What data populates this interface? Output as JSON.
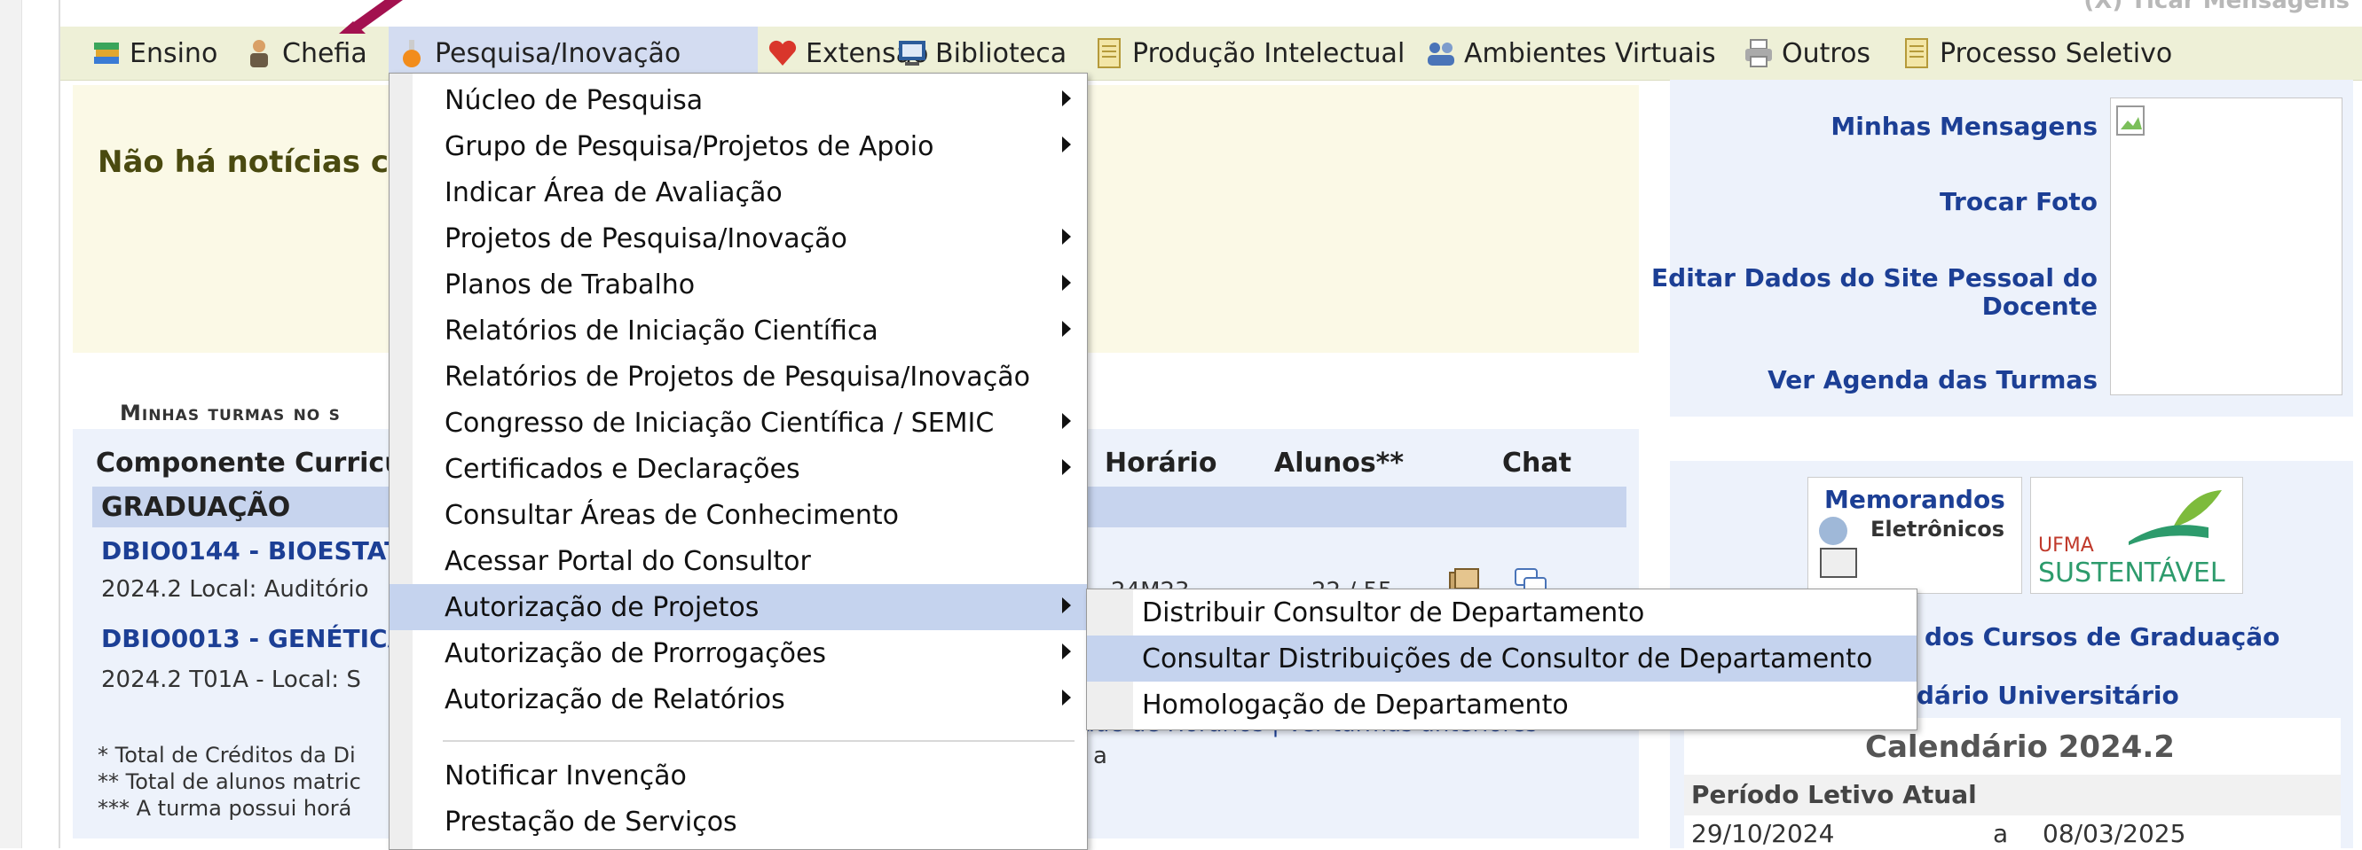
{
  "top_user": "(X) Ticar Mensagens",
  "menubar": {
    "items": [
      {
        "label": "Ensino",
        "icon": "books-icon"
      },
      {
        "label": "Chefia",
        "icon": "person-icon"
      },
      {
        "label": "Pesquisa/Inovação",
        "icon": "flask-icon"
      },
      {
        "label": "Extensão",
        "icon": "heart-icon"
      },
      {
        "label": "Biblioteca",
        "icon": "monitor-icon"
      },
      {
        "label": "Produção Intelectual",
        "icon": "document-icon"
      },
      {
        "label": "Ambientes Virtuais",
        "icon": "people-icon"
      },
      {
        "label": "Outros",
        "icon": "printer-icon"
      },
      {
        "label": "Processo Seletivo",
        "icon": "document-icon"
      }
    ]
  },
  "news": {
    "title": "Não há notícias c"
  },
  "turmas": {
    "heading": "Minhas turmas no s",
    "headers": {
      "componente": "Componente Curricu",
      "horario": "Horário",
      "alunos": "Alunos**",
      "chat": "Chat"
    },
    "group": "GRADUAÇÃO",
    "rows": [
      {
        "link": "DBIO0144 - BIOESTAT",
        "info": "2024.2 Local: Auditório",
        "horario": "24M23",
        "alunos": "22 / 55"
      },
      {
        "link": "DBIO0013 - GENÉTICA",
        "info": "2024.2 T01A - Local: S"
      }
    ],
    "notes": [
      "* Total de Créditos da Di",
      "** Total de alunos matric",
      "*** A turma possui horá"
    ],
    "faint_links": "ade de Horários | Ver turmas anteriores",
    "faint_a": "a"
  },
  "right": {
    "links": [
      "Minhas Mensagens",
      "Trocar Foto",
      "Editar Dados do Site Pessoal do",
      "Docente",
      "Ver Agenda das Turmas"
    ],
    "memorandos_line1": "Memorandos",
    "memorandos_line2": "Eletrônicos",
    "ufma": "UFMA",
    "sustentavel": "SUSTENTÁVEL",
    "cursos_link": "o dos Cursos de Graduação",
    "calendario_link": "ndário Universitário",
    "calendar": {
      "title": "Calendário 2024.2",
      "subtitle": "Período Letivo Atual",
      "start": "29/10/2024",
      "sep": "a",
      "end": "08/03/2025"
    }
  },
  "dropdown": {
    "items": [
      {
        "label": "Núcleo de Pesquisa",
        "submenu": true
      },
      {
        "label": "Grupo de Pesquisa/Projetos de Apoio",
        "submenu": true
      },
      {
        "label": "Indicar Área de Avaliação",
        "submenu": false
      },
      {
        "label": "Projetos de Pesquisa/Inovação",
        "submenu": true
      },
      {
        "label": "Planos de Trabalho",
        "submenu": true
      },
      {
        "label": "Relatórios de Iniciação Científica",
        "submenu": true
      },
      {
        "label": "Relatórios de Projetos de Pesquisa/Inovação",
        "submenu": false
      },
      {
        "label": "Congresso de Iniciação Científica / SEMIC",
        "submenu": true
      },
      {
        "label": "Certificados e Declarações",
        "submenu": true
      },
      {
        "label": "Consultar Áreas de Conhecimento",
        "submenu": false
      },
      {
        "label": "Acessar Portal do Consultor",
        "submenu": false
      },
      {
        "label": "Autorização de Projetos",
        "submenu": true
      },
      {
        "label": "Autorização de Prorrogações",
        "submenu": true
      },
      {
        "label": "Autorização de Relatórios",
        "submenu": true
      },
      {
        "label": "Notificar Invenção",
        "submenu": false
      },
      {
        "label": "Prestação de Serviços",
        "submenu": false
      }
    ]
  },
  "submenu": {
    "items": [
      "Distribuir Consultor de Departamento",
      "Consultar Distribuições de Consultor de Departamento",
      "Homologação de Departamento"
    ]
  },
  "colors": {
    "menubar": "#eef0d7",
    "highlight": "#c5d3ee",
    "link": "#1c3f95",
    "arrow": "#a3114f"
  }
}
